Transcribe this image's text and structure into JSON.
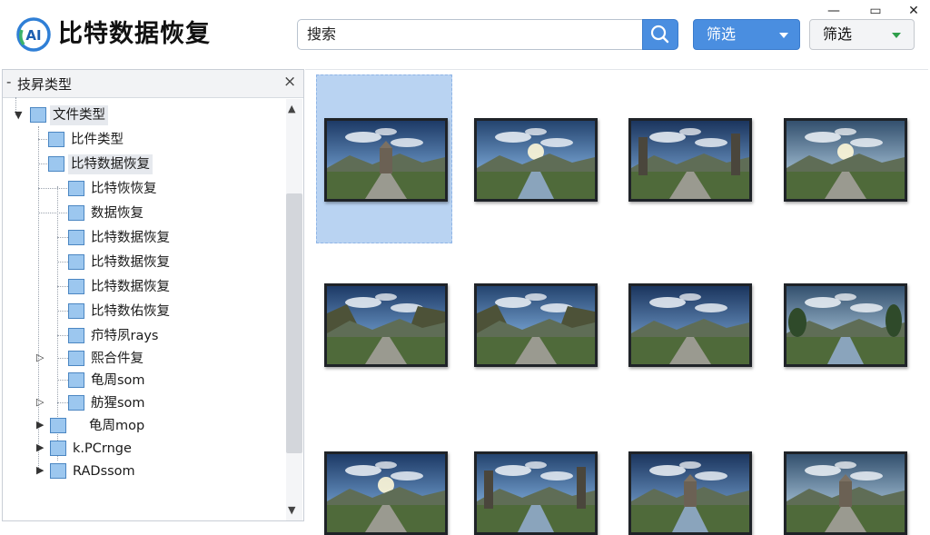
{
  "app": {
    "title": "比特数据恢复",
    "logo_text": "AI"
  },
  "header": {
    "search_value": "搜索",
    "filter_primary": {
      "label": "筛选"
    },
    "filter_secondary": {
      "label": "筛选"
    }
  },
  "window": {
    "minimize_glyph": "—",
    "maximize_glyph": "▭",
    "close_glyph": "✕"
  },
  "left_panel": {
    "title": "技昇类型",
    "tree": [
      {
        "label": "文件类型"
      },
      {
        "label": "比件类型"
      },
      {
        "label": "比特数据恢复"
      },
      {
        "label": "比特恢恢复"
      },
      {
        "label": "数据恢复"
      },
      {
        "label": "比特数据恢复"
      },
      {
        "label": "比特数据恢复"
      },
      {
        "label": "比特数据恢复"
      },
      {
        "label": "比特数佑恢复"
      },
      {
        "label": "疖特夙rays"
      },
      {
        "label": "熙合件复"
      },
      {
        "label": "龟周som"
      },
      {
        "label": "舫猩som"
      },
      {
        "label": "龟周mop"
      },
      {
        "label": "k.PCrnge"
      },
      {
        "label": "RADssom"
      }
    ]
  },
  "colors": {
    "accent": "#4a8ee0",
    "selection": "#b9d3f2",
    "folder": "#9cc7ef"
  },
  "thumbnails": [
    {
      "scene": "tower-road"
    },
    {
      "scene": "river-sun"
    },
    {
      "scene": "rock-pillars"
    },
    {
      "scene": "green-valley"
    },
    {
      "scene": "mountain-road"
    },
    {
      "scene": "cliff-road"
    },
    {
      "scene": "stone-road"
    },
    {
      "scene": "tree-bridge"
    },
    {
      "scene": "sun-valley"
    },
    {
      "scene": "rock-river"
    },
    {
      "scene": "tower-river"
    },
    {
      "scene": "tower-plaza"
    }
  ]
}
